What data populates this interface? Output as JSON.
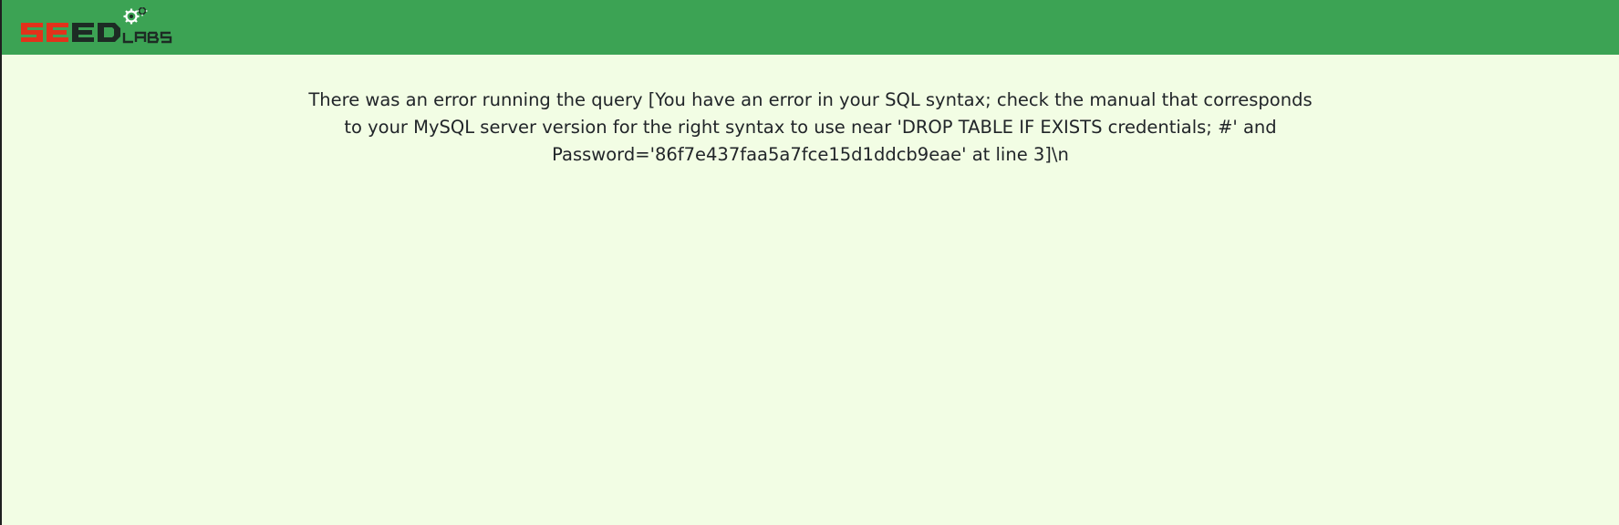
{
  "brand": {
    "logo_text": "SEEDLABS",
    "logo_icon": "gear-icon"
  },
  "colors": {
    "navbar": "#3ca354",
    "page_background": "#f2fde4",
    "text": "#212529",
    "logo_red": "#e2321b",
    "logo_dark": "#1d2b24"
  },
  "main": {
    "error_message": "There was an error running the query [You have an error in your SQL syntax; check the manual that corresponds to your MySQL server version for the right syntax to use near 'DROP TABLE IF EXISTS credentials; #' and Password='86f7e437faa5a7fce15d1ddcb9eae' at line 3]\\n"
  }
}
